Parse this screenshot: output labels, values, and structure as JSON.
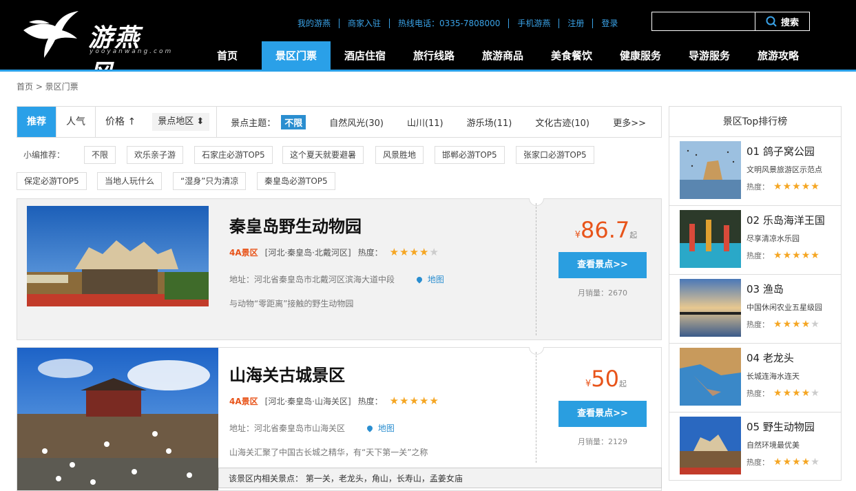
{
  "logo": {
    "text": "游燕风",
    "sub": "yooyanwang.com"
  },
  "top_links": [
    "我的游燕",
    "商家入驻",
    "热线电话：0335-7808000",
    "手机游燕",
    "注册",
    "登录"
  ],
  "search": {
    "placeholder": "",
    "button": "搜索"
  },
  "nav": [
    "首页",
    "景区门票",
    "酒店住宿",
    "旅行线路",
    "旅游商品",
    "美食餐饮",
    "健康服务",
    "导游服务",
    "旅游攻略"
  ],
  "nav_active": 1,
  "breadcrumb": "首页 > 景区门票",
  "sort": {
    "recommend": "推荐",
    "popular": "人气",
    "price": "价格 ↑",
    "region": "景点地区 ⬍"
  },
  "theme": {
    "label": "景点主题：",
    "items": [
      "不限",
      "自然风光(30)",
      "山川(11)",
      "游乐场(11)",
      "文化古迹(10)"
    ],
    "more": "更多>>"
  },
  "recommend": {
    "label": "小编推荐：",
    "tags": [
      "不限",
      "欢乐亲子游",
      "石家庄必游TOP5",
      "这个夏天就要避暑",
      "风景胜地",
      "邯郸必游TOP5",
      "张家口必游TOP5",
      "保定必游TOP5",
      "当地人玩什么",
      "“湿身”只为清凉",
      "秦皇岛必游TOP5"
    ]
  },
  "cards": [
    {
      "title": "秦皇岛野生动物园",
      "level": "4A景区",
      "region": "[河北·秦皇岛·北戴河区]",
      "heat_label": "热度：",
      "stars": 4,
      "address": "地址：河北省秦皇岛市北戴河区滨海大道中段",
      "map": "地图",
      "desc": "与动物“零距离”接触的野生动物园",
      "currency": "¥",
      "price": "86.7",
      "price_suffix": "起",
      "button": "查看景点>>",
      "sales": "月销量：2670"
    },
    {
      "title": "山海关古城景区",
      "level": "4A景区",
      "region": "[河北·秦皇岛·山海关区]",
      "heat_label": "热度：",
      "stars": 5,
      "address": "地址：河北省秦皇岛市山海关区",
      "map": "地图",
      "desc": "山海关汇聚了中国古长城之精华，有“天下第一关”之称",
      "currency": "¥",
      "price": "50",
      "price_suffix": "起",
      "button": "查看景点>>",
      "sales": "月销量：2129",
      "related": "该景区内相关景点：  第一关，老龙头，角山，长寿山，孟姜女庙"
    }
  ],
  "sidebar": {
    "title": "景区Top排行榜",
    "heat_label": "热度：",
    "items": [
      {
        "name": "01 鸽子窝公园",
        "sub": "文明风景旅游区示范点",
        "stars": 5
      },
      {
        "name": "02 乐岛海洋王国",
        "sub": "尽享清凉水乐园",
        "stars": 5
      },
      {
        "name": "03 渔岛",
        "sub": "中国休闲农业五星级园",
        "stars": 4
      },
      {
        "name": "04 老龙头",
        "sub": "长城连海水连天",
        "stars": 4
      },
      {
        "name": "05 野生动物园",
        "sub": "自然环境最优美",
        "stars": 4
      }
    ]
  },
  "colors": {
    "accent": "#2aa0e8",
    "price": "#e8541a",
    "star": "#f5a623",
    "header": "#000000"
  }
}
